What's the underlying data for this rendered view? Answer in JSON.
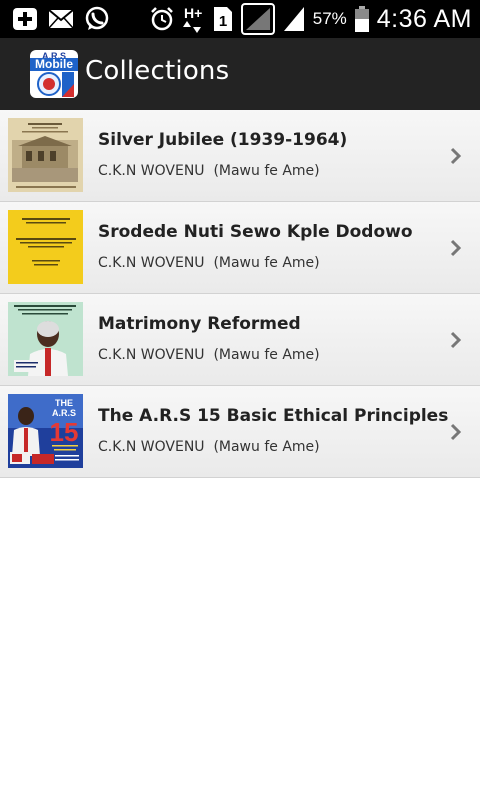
{
  "status_bar": {
    "battery_percent": "57%",
    "time": "4:36 AM",
    "sim_label": "1",
    "network_type": "H+"
  },
  "action_bar": {
    "logo_text_top": "A.R.S",
    "logo_text_bottom": "Mobile",
    "title": "Collections"
  },
  "collections": [
    {
      "title": "Silver Jubilee (1939-1964)",
      "author": "C.K.N WOVENU  (Mawu fe Ame)"
    },
    {
      "title": "Srodede Nuti Sewo Kple Dodowo",
      "author": "C.K.N WOVENU  (Mawu fe Ame)"
    },
    {
      "title": "Matrimony Reformed",
      "author": "C.K.N WOVENU  (Mawu fe Ame)"
    },
    {
      "title": "The A.R.S 15 Basic Ethical Principles",
      "author": "C.K.N WOVENU  (Mawu fe Ame)"
    }
  ],
  "cover_texts": {
    "book4_line1": "THE",
    "book4_line2": "A.R.S",
    "book4_number": "15"
  },
  "colors": {
    "action_bar": "#232323",
    "status_bar": "#000000",
    "row_background": "#eeeeee",
    "title_text": "#222222",
    "chevron": "#777777"
  }
}
